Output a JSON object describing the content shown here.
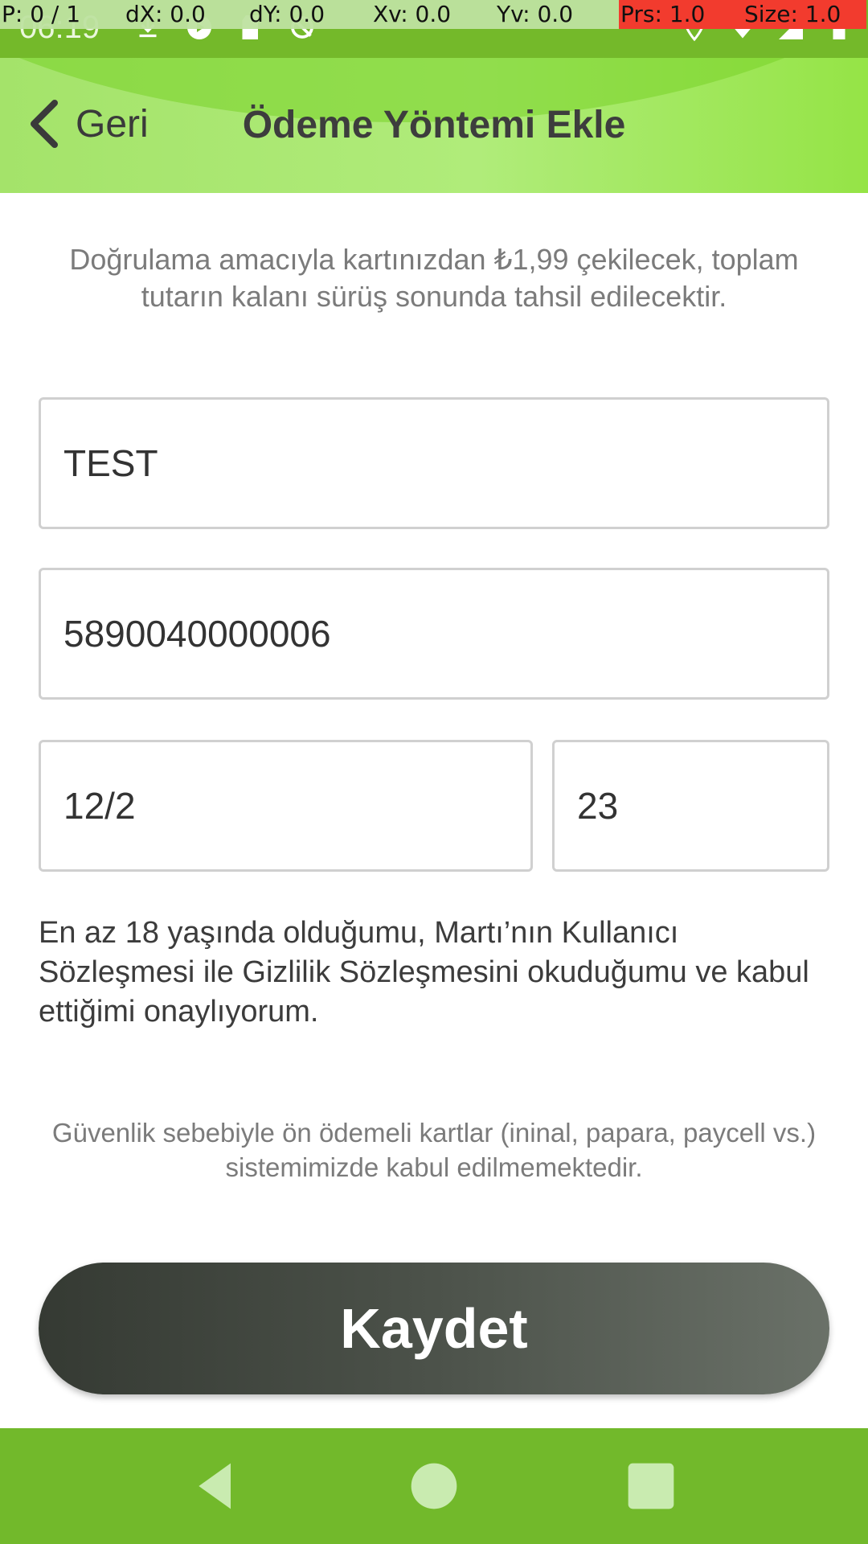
{
  "debug": {
    "pointer": "P: 0 / 1",
    "dx": "dX: 0.0",
    "dy": "dY: 0.0",
    "xv": "Xv: 0.0",
    "yv": "Yv: 0.0",
    "prs": "Prs: 1.0",
    "size": "Size: 1.0"
  },
  "status_bar": {
    "time": "06:19",
    "left_icons": [
      "download-icon",
      "media-icon",
      "sd-card-icon",
      "sync-icon"
    ],
    "right_icons": [
      "location-icon",
      "wifi-icon",
      "signal-icon",
      "battery-icon"
    ]
  },
  "header": {
    "back_label": "Geri",
    "title": "Ödeme Yöntemi Ekle"
  },
  "form": {
    "info_text": "Doğrulama amacıyla kartınızdan ₺1,99 çekilecek, toplam tutarın kalanı sürüş sonunda tahsil edilecektir.",
    "card_holder_value": "TEST",
    "card_number_value": "5890040000006",
    "expiry_value": "12/2",
    "cvc_value": "23",
    "consent_text": "En az 18 yaşında olduğumu, Martı’nın Kullanıcı Sözleşmesi ile Gizlilik Sözleşmesini okuduğumu ve kabul ettiğimi onaylıyorum.",
    "prepaid_note": "Güvenlik sebebiyle ön ödemeli kartlar (ininal, papara, paycell vs.) sistemimizde kabul edilmemektedir.",
    "save_label": "Kaydet"
  },
  "colors": {
    "status_bar": "#74b92a",
    "header_light": "#a4e36a",
    "nav_bar": "#72b92b",
    "button_dark": "#353a33"
  }
}
